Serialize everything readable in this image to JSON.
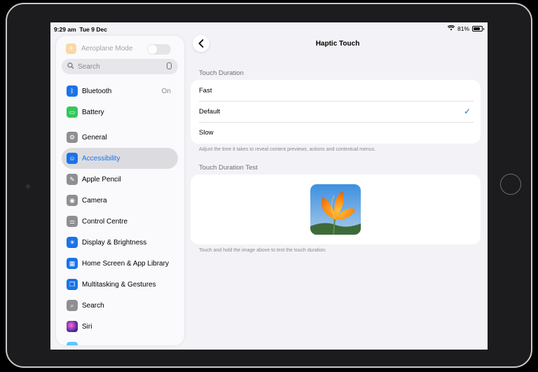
{
  "status": {
    "time": "9:29 am",
    "date": "Tue 9 Dec",
    "battery": "81%"
  },
  "sidebar": {
    "airplane_label": "Aeroplane Mode",
    "search_placeholder": "Search",
    "items": [
      {
        "label": "Bluetooth",
        "value": "On",
        "color": "#1a73e8",
        "icon": "bluetooth-icon"
      },
      {
        "label": "Battery",
        "value": "",
        "color": "#34c759",
        "icon": "battery-icon"
      },
      {
        "label": "General",
        "value": "",
        "color": "#8e8e93",
        "icon": "gear-icon"
      },
      {
        "label": "Accessibility",
        "value": "",
        "color": "#1a73e8",
        "icon": "accessibility-icon",
        "selected": true
      },
      {
        "label": "Apple Pencil",
        "value": "",
        "color": "#8e8e93",
        "icon": "pencil-icon"
      },
      {
        "label": "Camera",
        "value": "",
        "color": "#8e8e93",
        "icon": "camera-icon"
      },
      {
        "label": "Control Centre",
        "value": "",
        "color": "#8e8e93",
        "icon": "toggles-icon"
      },
      {
        "label": "Display & Brightness",
        "value": "",
        "color": "#1a73e8",
        "icon": "sun-icon"
      },
      {
        "label": "Home Screen & App Library",
        "value": "",
        "color": "#1a73e8",
        "icon": "home-screen-icon"
      },
      {
        "label": "Multitasking & Gestures",
        "value": "",
        "color": "#1a73e8",
        "icon": "multitasking-icon"
      },
      {
        "label": "Search",
        "value": "",
        "color": "#8e8e93",
        "icon": "search-icon"
      },
      {
        "label": "Siri",
        "value": "",
        "color": "#5e2ca5",
        "icon": "siri-icon"
      }
    ]
  },
  "main": {
    "title": "Haptic Touch",
    "duration_header": "Touch Duration",
    "options": [
      "Fast",
      "Default",
      "Slow"
    ],
    "selected_option": "Default",
    "duration_footer": "Adjust the time it takes to reveal content previews, actions and contextual menus.",
    "test_header": "Touch Duration Test",
    "test_footer": "Touch and hold the image above to test the touch duration."
  }
}
